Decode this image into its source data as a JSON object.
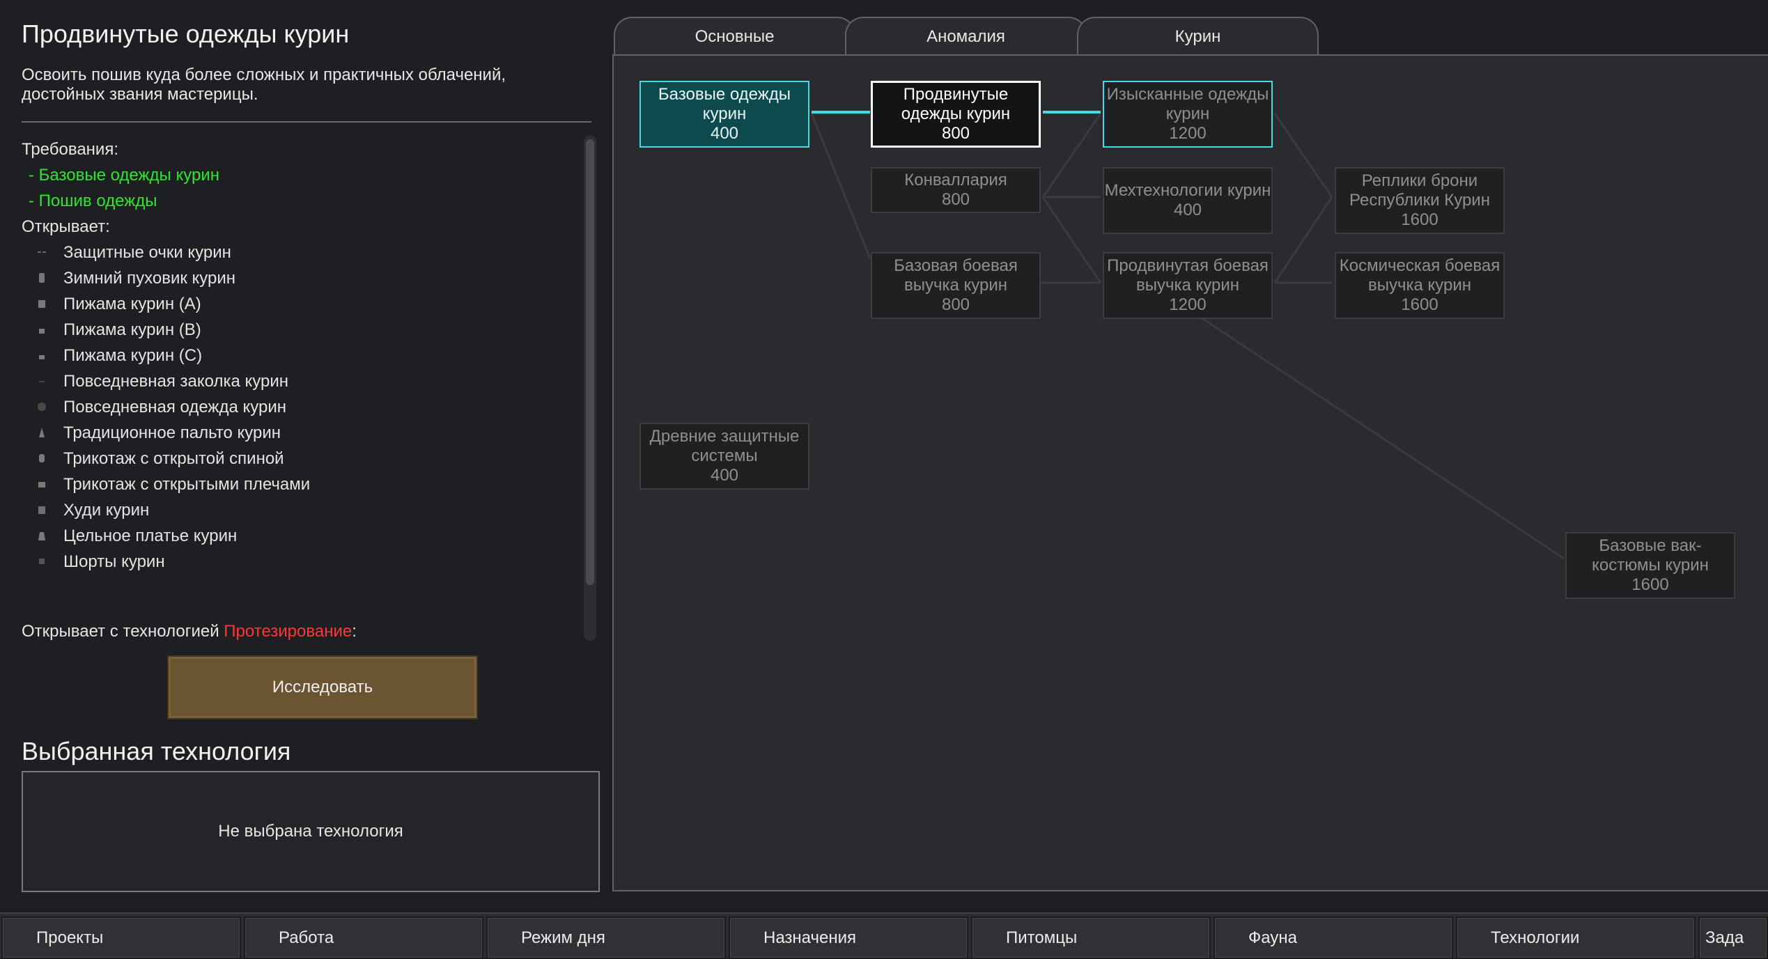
{
  "project": {
    "title": "Продвинутые одежды курин",
    "description": "Освоить пошив куда более сложных и практичных облачений, достойных звания мастерицы.",
    "requirements_label": "Требования:",
    "requirements": [
      "- Базовые одежды курин",
      "- Пошив одежды"
    ],
    "unlocks_label": "Открывает:",
    "unlocks": [
      {
        "label": "Защитные очки курин",
        "icon": "goggles-icon"
      },
      {
        "label": "Зимний пуховик курин",
        "icon": "parka-icon"
      },
      {
        "label": "Пижама курин (A)",
        "icon": "pajama-icon"
      },
      {
        "label": "Пижама курин (B)",
        "icon": "pajama-icon"
      },
      {
        "label": "Пижама курин (C)",
        "icon": "pajama-icon"
      },
      {
        "label": "Повседневная заколка курин",
        "icon": "hairpin-icon"
      },
      {
        "label": "Повседневная одежда курин",
        "icon": "casual-clothes-icon"
      },
      {
        "label": "Традиционное пальто курин",
        "icon": "coat-icon"
      },
      {
        "label": "Трикотаж с открытой спиной",
        "icon": "knitwear-icon"
      },
      {
        "label": "Трикотаж с открытыми плечами",
        "icon": "knitwear-icon"
      },
      {
        "label": "Худи курин",
        "icon": "hoodie-icon"
      },
      {
        "label": "Цельное платье курин",
        "icon": "dress-icon"
      },
      {
        "label": "Шорты курин",
        "icon": "shorts-icon"
      }
    ],
    "tech_unlock_prefix": "Открывает с технологией ",
    "tech_unlock_name": "Протезирование",
    "tech_unlock_suffix": ":",
    "research_button": "Исследовать"
  },
  "selected_tech": {
    "title": "Выбранная технология",
    "empty_text": "Не выбрана технология"
  },
  "tabs": [
    "Основные",
    "Аномалия",
    "Курин"
  ],
  "tree_nodes": [
    {
      "id": "n1",
      "label": "Базовые одежды курин",
      "cost": "400",
      "state": "done"
    },
    {
      "id": "n2",
      "label": "Продвинутые одежды курин",
      "cost": "800",
      "state": "selected"
    },
    {
      "id": "n3",
      "label": "Изысканные одежды курин",
      "cost": "1200",
      "state": "available"
    },
    {
      "id": "n4",
      "label": "Конваллария",
      "cost": "800",
      "state": "locked"
    },
    {
      "id": "n5",
      "label": "Мехтехнологии курин",
      "cost": "400",
      "state": "locked"
    },
    {
      "id": "n6",
      "label": "Реплики брони Республики Курин",
      "cost": "1600",
      "state": "locked"
    },
    {
      "id": "n7",
      "label": "Базовая боевая выучка курин",
      "cost": "800",
      "state": "locked"
    },
    {
      "id": "n8",
      "label": "Продвинутая боевая выучка курин",
      "cost": "1200",
      "state": "locked"
    },
    {
      "id": "n9",
      "label": "Космическая боевая выучка курин",
      "cost": "1600",
      "state": "locked"
    },
    {
      "id": "n10",
      "label": "Древние защитные системы",
      "cost": "400",
      "state": "locked"
    },
    {
      "id": "n11",
      "label": "Базовые вак-костюмы курин",
      "cost": "1600",
      "state": "locked"
    }
  ],
  "bottom_tabs": [
    "Проекты",
    "Работа",
    "Режим дня",
    "Назначения",
    "Питомцы",
    "Фауна",
    "Технологии",
    "Зада"
  ],
  "colors": {
    "accent": "#4ad7e6",
    "requirement_met": "#2ee62e",
    "warning": "#ff3636",
    "button": "#6b5431"
  }
}
